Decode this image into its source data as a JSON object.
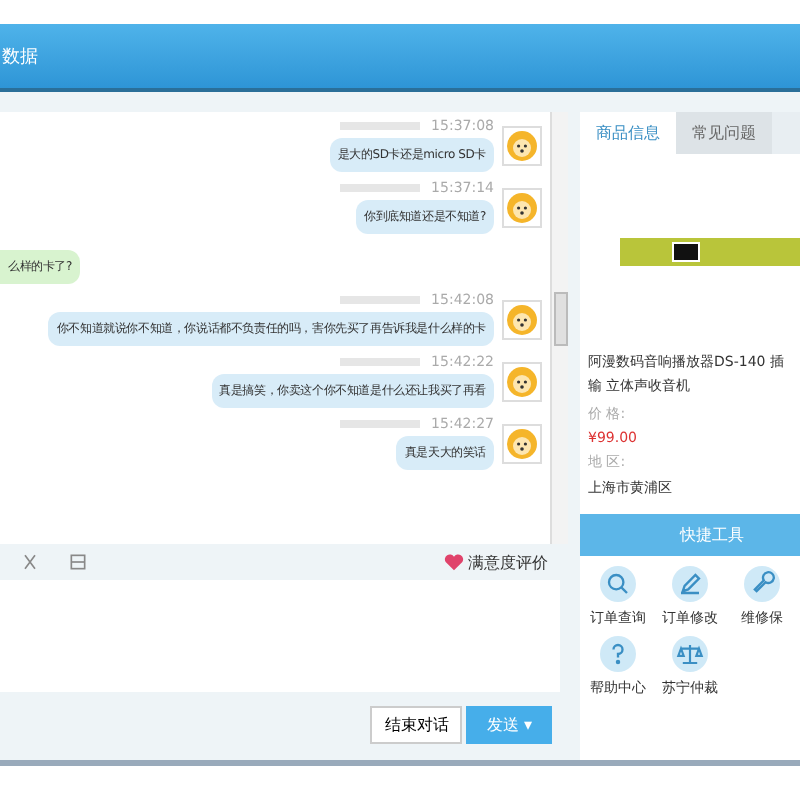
{
  "window": {
    "title": "数据"
  },
  "messages": [
    {
      "kind": "sent",
      "time": "15:37:08",
      "text": "是大的SD卡还是micro SD卡"
    },
    {
      "kind": "sent",
      "time": "15:37:14",
      "text": "你到底知道还是不知道?"
    },
    {
      "kind": "received",
      "text": "么样的卡了?"
    },
    {
      "kind": "sent",
      "time": "15:42:08",
      "text": "你不知道就说你不知道，你说话都不负责任的吗，害你先买了再告诉我是什么样的卡"
    },
    {
      "kind": "sent",
      "time": "15:42:22",
      "text": "真是搞笑，你卖这个你不知道是什么还让我买了再看"
    },
    {
      "kind": "sent",
      "time": "15:42:27",
      "text": "真是天大的笑话"
    }
  ],
  "toolbar": {
    "rating": "满意度评价"
  },
  "actions": {
    "end": "结束对话",
    "send": "发送",
    "send_caret": "▾"
  },
  "tabs": [
    {
      "label": "商品信息",
      "selected": true
    },
    {
      "label": "常见问题",
      "selected": false
    }
  ],
  "product": {
    "name": "阿漫数码音响播放器DS-140 插输 立体声收音机",
    "price_label": "价 格:",
    "price": "¥99.00",
    "region_label": "地 区:",
    "region": "上海市黄浦区"
  },
  "tools": {
    "title": "快捷工具",
    "items": [
      {
        "kind": "search",
        "label": "订单查询"
      },
      {
        "kind": "edit",
        "label": "订单修改"
      },
      {
        "kind": "wrench",
        "label": "维修保"
      },
      {
        "kind": "help",
        "label": "帮助中心"
      },
      {
        "kind": "scale",
        "label": "苏宁仲裁"
      }
    ]
  }
}
